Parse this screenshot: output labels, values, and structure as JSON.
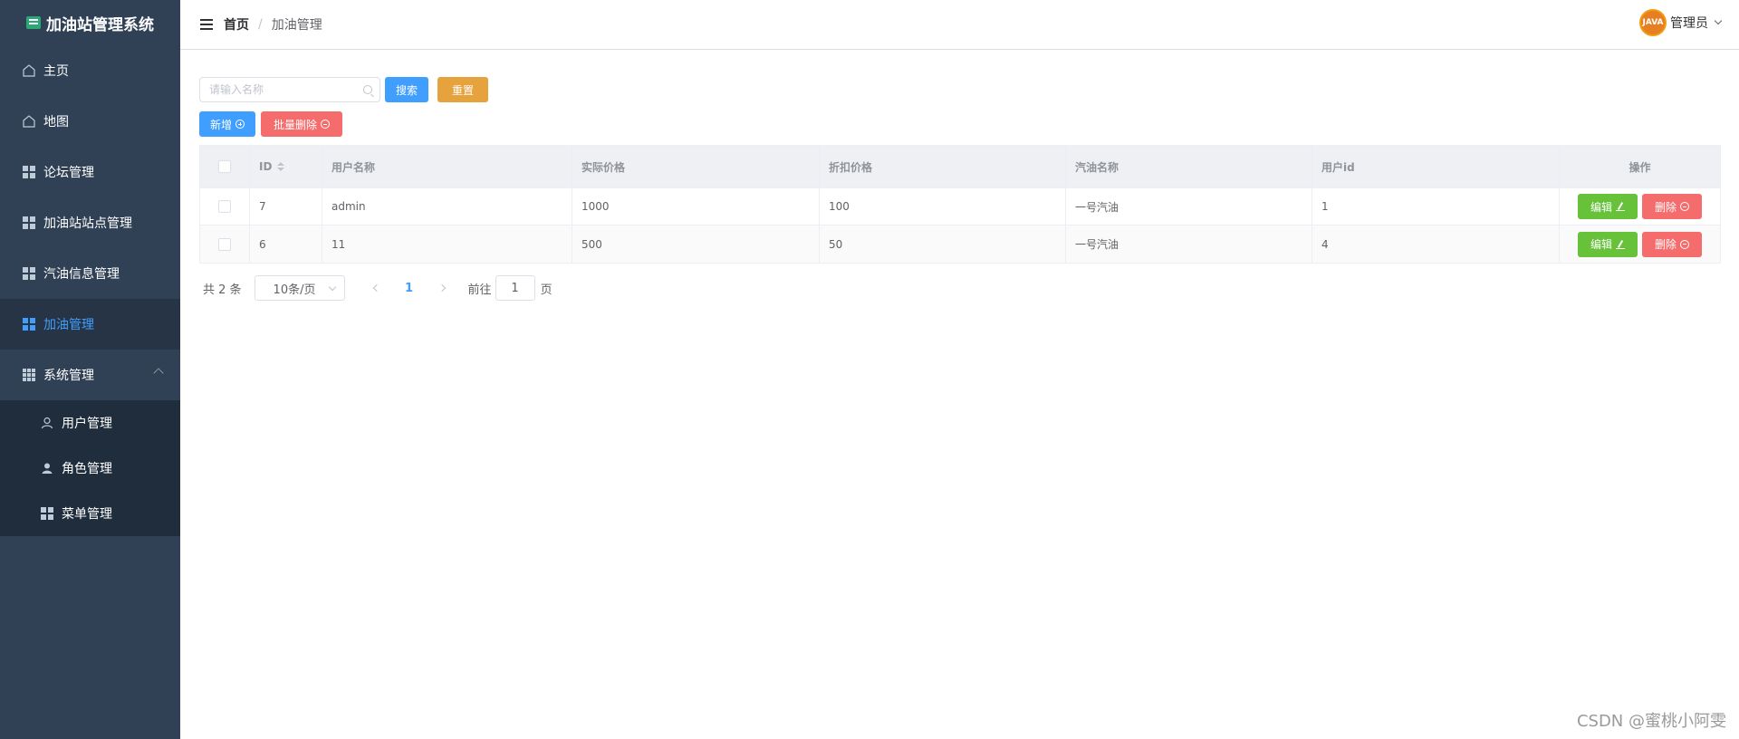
{
  "sidebar": {
    "title": "加油站管理系统",
    "items": [
      {
        "label": "主页",
        "icon": "home-icon"
      },
      {
        "label": "地图",
        "icon": "home-icon"
      },
      {
        "label": "论坛管理",
        "icon": "grid-icon"
      },
      {
        "label": "加油站站点管理",
        "icon": "grid-icon"
      },
      {
        "label": "汽油信息管理",
        "icon": "grid-icon"
      },
      {
        "label": "加油管理",
        "icon": "grid-icon",
        "active": true
      },
      {
        "label": "系统管理",
        "icon": "grid9-icon",
        "expanded": true
      }
    ],
    "sub_items": [
      {
        "label": "用户管理",
        "icon": "user-icon"
      },
      {
        "label": "角色管理",
        "icon": "user-filled-icon"
      },
      {
        "label": "菜单管理",
        "icon": "grid-icon"
      }
    ]
  },
  "header": {
    "breadcrumb_home": "首页",
    "breadcrumb_sep": "/",
    "breadcrumb_current": "加油管理",
    "avatar_text": "JAVA",
    "user_name": "管理员"
  },
  "toolbar": {
    "search_placeholder": "请输入名称",
    "search_label": "搜索",
    "reset_label": "重置",
    "add_label": "新增",
    "batch_delete_label": "批量删除"
  },
  "table": {
    "columns": [
      "ID",
      "用户名称",
      "实际价格",
      "折扣价格",
      "汽油名称",
      "用户id",
      "操作"
    ],
    "rows": [
      {
        "id": "7",
        "user_name": "admin",
        "actual_price": "1000",
        "discount_price": "100",
        "oil_name": "一号汽油",
        "user_id": "1"
      },
      {
        "id": "6",
        "user_name": "11",
        "actual_price": "500",
        "discount_price": "50",
        "oil_name": "一号汽油",
        "user_id": "4"
      }
    ],
    "edit_label": "编辑",
    "delete_label": "删除"
  },
  "pagination": {
    "total_text": "共 2 条",
    "page_size": "10条/页",
    "current_page": "1",
    "goto_prefix": "前往",
    "goto_value": "1",
    "goto_suffix": "页"
  },
  "watermark": "CSDN @蜜桃小阿雯",
  "colors": {
    "sidebar_bg": "#304156",
    "primary": "#409eff",
    "success": "#67c23a",
    "warning": "#e6a23c",
    "danger": "#f56c6c"
  }
}
